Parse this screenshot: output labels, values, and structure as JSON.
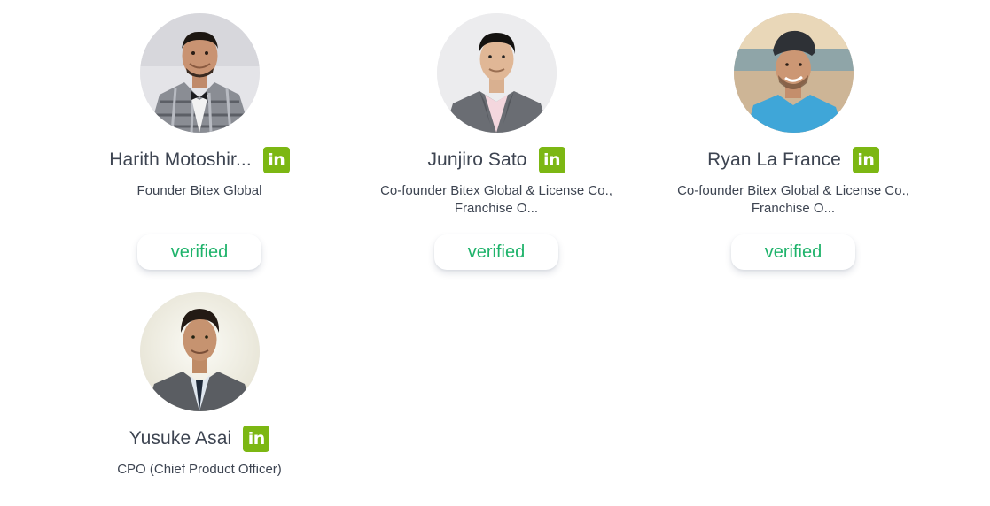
{
  "team": [
    {
      "name": "Harith Motoshir...",
      "role": "Founder Bitex Global",
      "linkedin_label": "in",
      "verified_label": "verified"
    },
    {
      "name": "Junjiro Sato",
      "role": "Co-founder Bitex Global & License Co., Franchise O...",
      "linkedin_label": "in",
      "verified_label": "verified"
    },
    {
      "name": "Ryan La France",
      "role": "Co-founder Bitex Global & License Co., Franchise O...",
      "linkedin_label": "in",
      "verified_label": "verified"
    },
    {
      "name": "Yusuke Asai",
      "role": "CPO (Chief Product Officer)",
      "linkedin_label": "in"
    }
  ],
  "colors": {
    "linkedin_badge": "#7cb713",
    "verified_text": "#1fb36b",
    "text": "#3d4451"
  }
}
